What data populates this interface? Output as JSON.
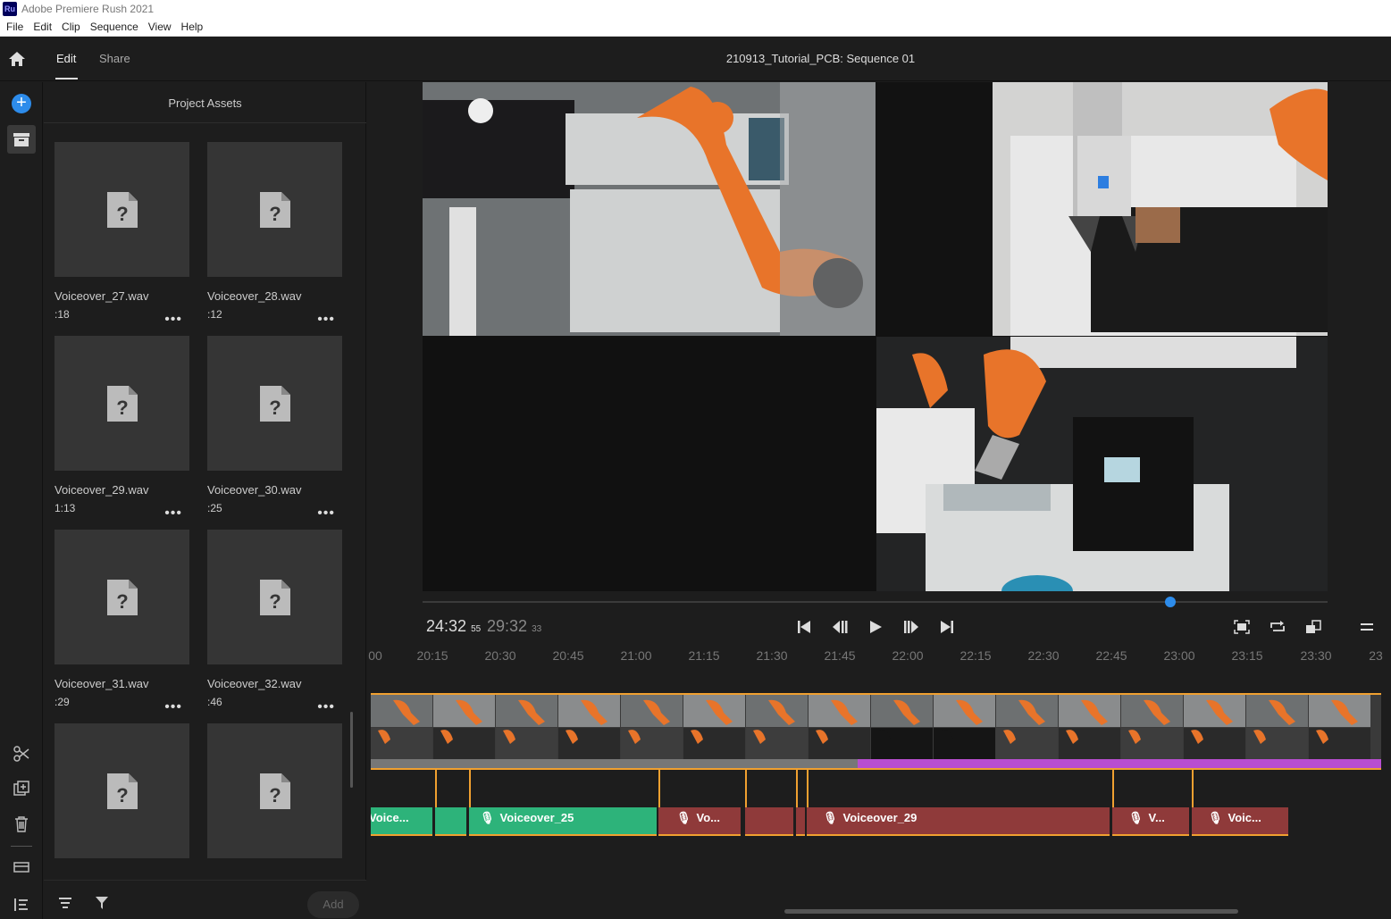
{
  "app": {
    "logo": "Ru",
    "title": "Adobe Premiere Rush 2021"
  },
  "menu": [
    "File",
    "Edit",
    "Clip",
    "Sequence",
    "View",
    "Help"
  ],
  "header": {
    "tabs": [
      "Edit",
      "Share"
    ],
    "active_tab": "Edit",
    "sequence_title": "210913_Tutorial_PCB: Sequence 01"
  },
  "rail": {
    "icons": [
      "home-icon",
      "add-media-icon",
      "project-assets-icon",
      "split-icon",
      "duplicate-icon",
      "delete-icon",
      "transitions-icon",
      "properties-icon"
    ]
  },
  "assets": {
    "title": "Project Assets",
    "items": [
      {
        "name": "Voiceover_27.wav",
        "duration": ":18"
      },
      {
        "name": "Voiceover_28.wav",
        "duration": ":12"
      },
      {
        "name": "Voiceover_29.wav",
        "duration": "1:13"
      },
      {
        "name": "Voiceover_30.wav",
        "duration": ":25"
      },
      {
        "name": "Voiceover_31.wav",
        "duration": ":29"
      },
      {
        "name": "Voiceover_32.wav",
        "duration": ":46"
      },
      {
        "name": "",
        "duration": ""
      },
      {
        "name": "",
        "duration": ""
      }
    ],
    "more_label": "•••",
    "add_label": "Add"
  },
  "transport": {
    "current": "24:32",
    "current_frames": "55",
    "duration": "29:32",
    "duration_frames": "33",
    "playhead_fraction": 0.825
  },
  "ruler": [
    "00",
    "20:15",
    "20:30",
    "20:45",
    "21:00",
    "21:15",
    "21:30",
    "21:45",
    "22:00",
    "22:15",
    "22:30",
    "22:45",
    "23:00",
    "23:15",
    "23:30",
    "23"
  ],
  "audio_clips": [
    {
      "label": "Voice...",
      "color": "green"
    },
    {
      "label": "",
      "color": "green"
    },
    {
      "label": "Voiceover_25",
      "color": "green"
    },
    {
      "label": "Vo...",
      "color": "red"
    },
    {
      "label": "",
      "color": "red"
    },
    {
      "label": "",
      "color": "red"
    },
    {
      "label": "Voiceover_29",
      "color": "red"
    },
    {
      "label": "V...",
      "color": "red"
    },
    {
      "label": "Voic...",
      "color": "red"
    }
  ],
  "colors": {
    "accent": "#2d8ceb",
    "clip_border": "#f0a030",
    "audio_green": "#2db37a",
    "audio_red": "#8f3a3a",
    "robot_orange": "#e8742a"
  }
}
